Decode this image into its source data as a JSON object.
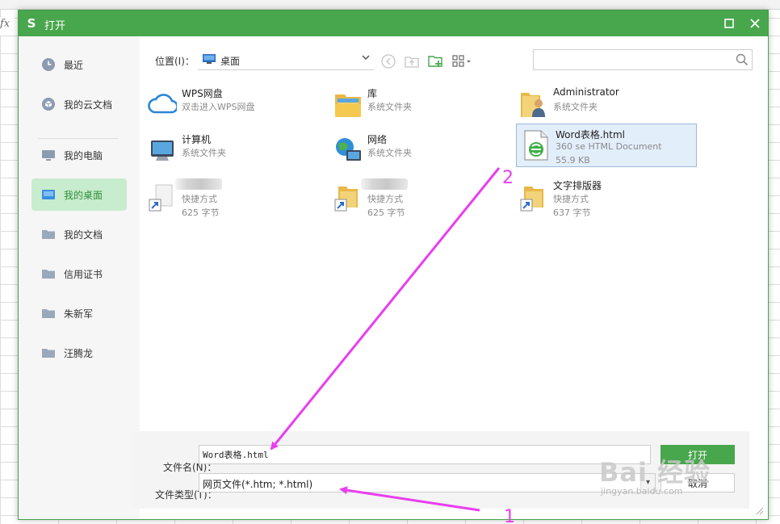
{
  "background": {
    "fx_label": "fx"
  },
  "dialog": {
    "title": "打开",
    "accent_color": "#48a64c",
    "controls": {
      "maximize": "□",
      "close": "✕"
    }
  },
  "sidebar": {
    "items": [
      {
        "label": "最近",
        "icon": "clock-icon",
        "active": false
      },
      {
        "label": "我的云文档",
        "icon": "cloud-doc-icon",
        "active": false
      },
      {
        "label": "我的电脑",
        "icon": "computer-icon",
        "active": false
      },
      {
        "label": "我的桌面",
        "icon": "desktop-icon",
        "active": true
      },
      {
        "label": "我的文档",
        "icon": "folder-icon",
        "active": false
      },
      {
        "label": "信用证书",
        "icon": "folder-icon",
        "active": false
      },
      {
        "label": "朱新军",
        "icon": "folder-icon",
        "active": false
      },
      {
        "label": "汪腾龙",
        "icon": "folder-icon",
        "active": false
      }
    ]
  },
  "toolbar": {
    "location_label": "位置(I)：",
    "location_value": "桌面",
    "search_placeholder": ""
  },
  "files": [
    {
      "name": "WPS网盘",
      "sub": "双击进入WPS网盘",
      "icon": "cloud-icon"
    },
    {
      "name": "库",
      "sub": "系统文件夹",
      "icon": "library-icon"
    },
    {
      "name": "Administrator",
      "sub": "系统文件夹",
      "icon": "user-folder-icon"
    },
    {
      "name": "计算机",
      "sub": "系统文件夹",
      "icon": "computer-icon"
    },
    {
      "name": "网络",
      "sub": "系统文件夹",
      "icon": "network-icon"
    },
    {
      "name": "Word表格.html",
      "sub": "360 se HTML Document",
      "sub2": "55.9 KB",
      "icon": "html-document-icon",
      "selected": true
    },
    {
      "name": "",
      "sub": "快捷方式",
      "sub2": "625 字节",
      "icon": "shortcut-icon",
      "blurred": true
    },
    {
      "name": "",
      "sub": "快捷方式",
      "sub2": "625 字节",
      "icon": "shortcut-icon",
      "blurred": true
    },
    {
      "name": "文字排版器",
      "sub": "快捷方式",
      "sub2": "637 字节",
      "icon": "shortcut-icon"
    }
  ],
  "form": {
    "filename_label": "文件名(N)：",
    "filename_value": "Word表格.html",
    "filetype_label": "文件类型(T)：",
    "filetype_value": "网页文件(*.htm; *.html)",
    "open_button": "打开",
    "cancel_button": "取消"
  },
  "annotations": {
    "color": "#e93ef0",
    "label_1": "1",
    "label_2": "2"
  },
  "watermark": {
    "brand": "Bai 经验",
    "url": "jingyan.baidu.com"
  }
}
